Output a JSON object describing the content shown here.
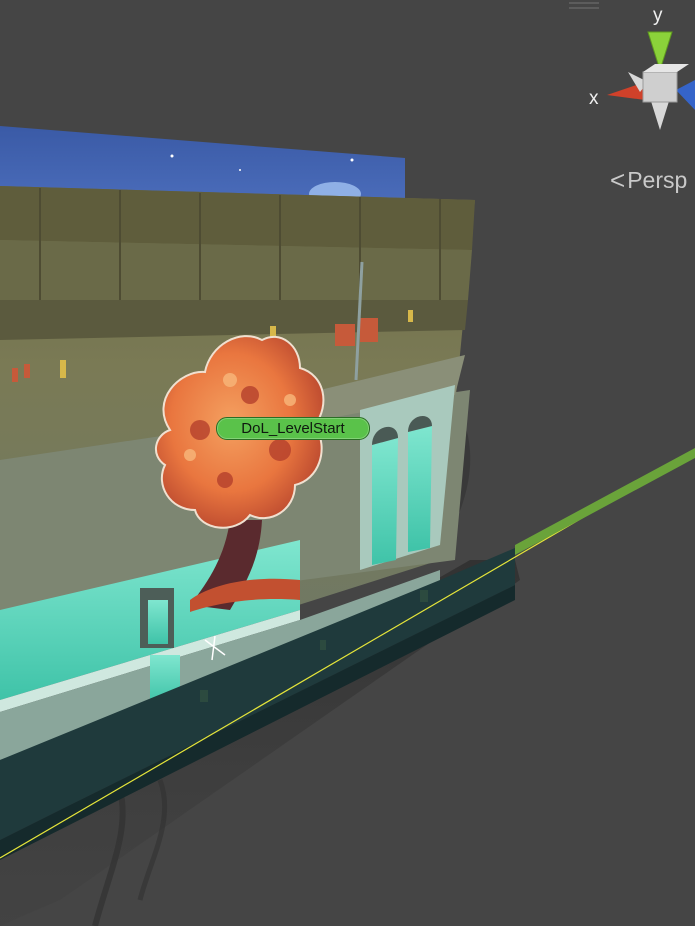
{
  "scene_view": {
    "projection_label": "Persp",
    "object_label": "DoL_LevelStart",
    "axis_y_label": "y",
    "axis_x_label": "x",
    "colors": {
      "background": "#454545",
      "axis_x": "#d0412a",
      "axis_y": "#8bd23a",
      "axis_z": "#3564c9",
      "label_pill": "#5ac24a",
      "ground_line": "#e5e53a"
    },
    "icons": [
      "scene-menu-handle-icon",
      "chevron-left-icon",
      "orientation-gizmo-icon",
      "pivot-cross-icon"
    ]
  }
}
